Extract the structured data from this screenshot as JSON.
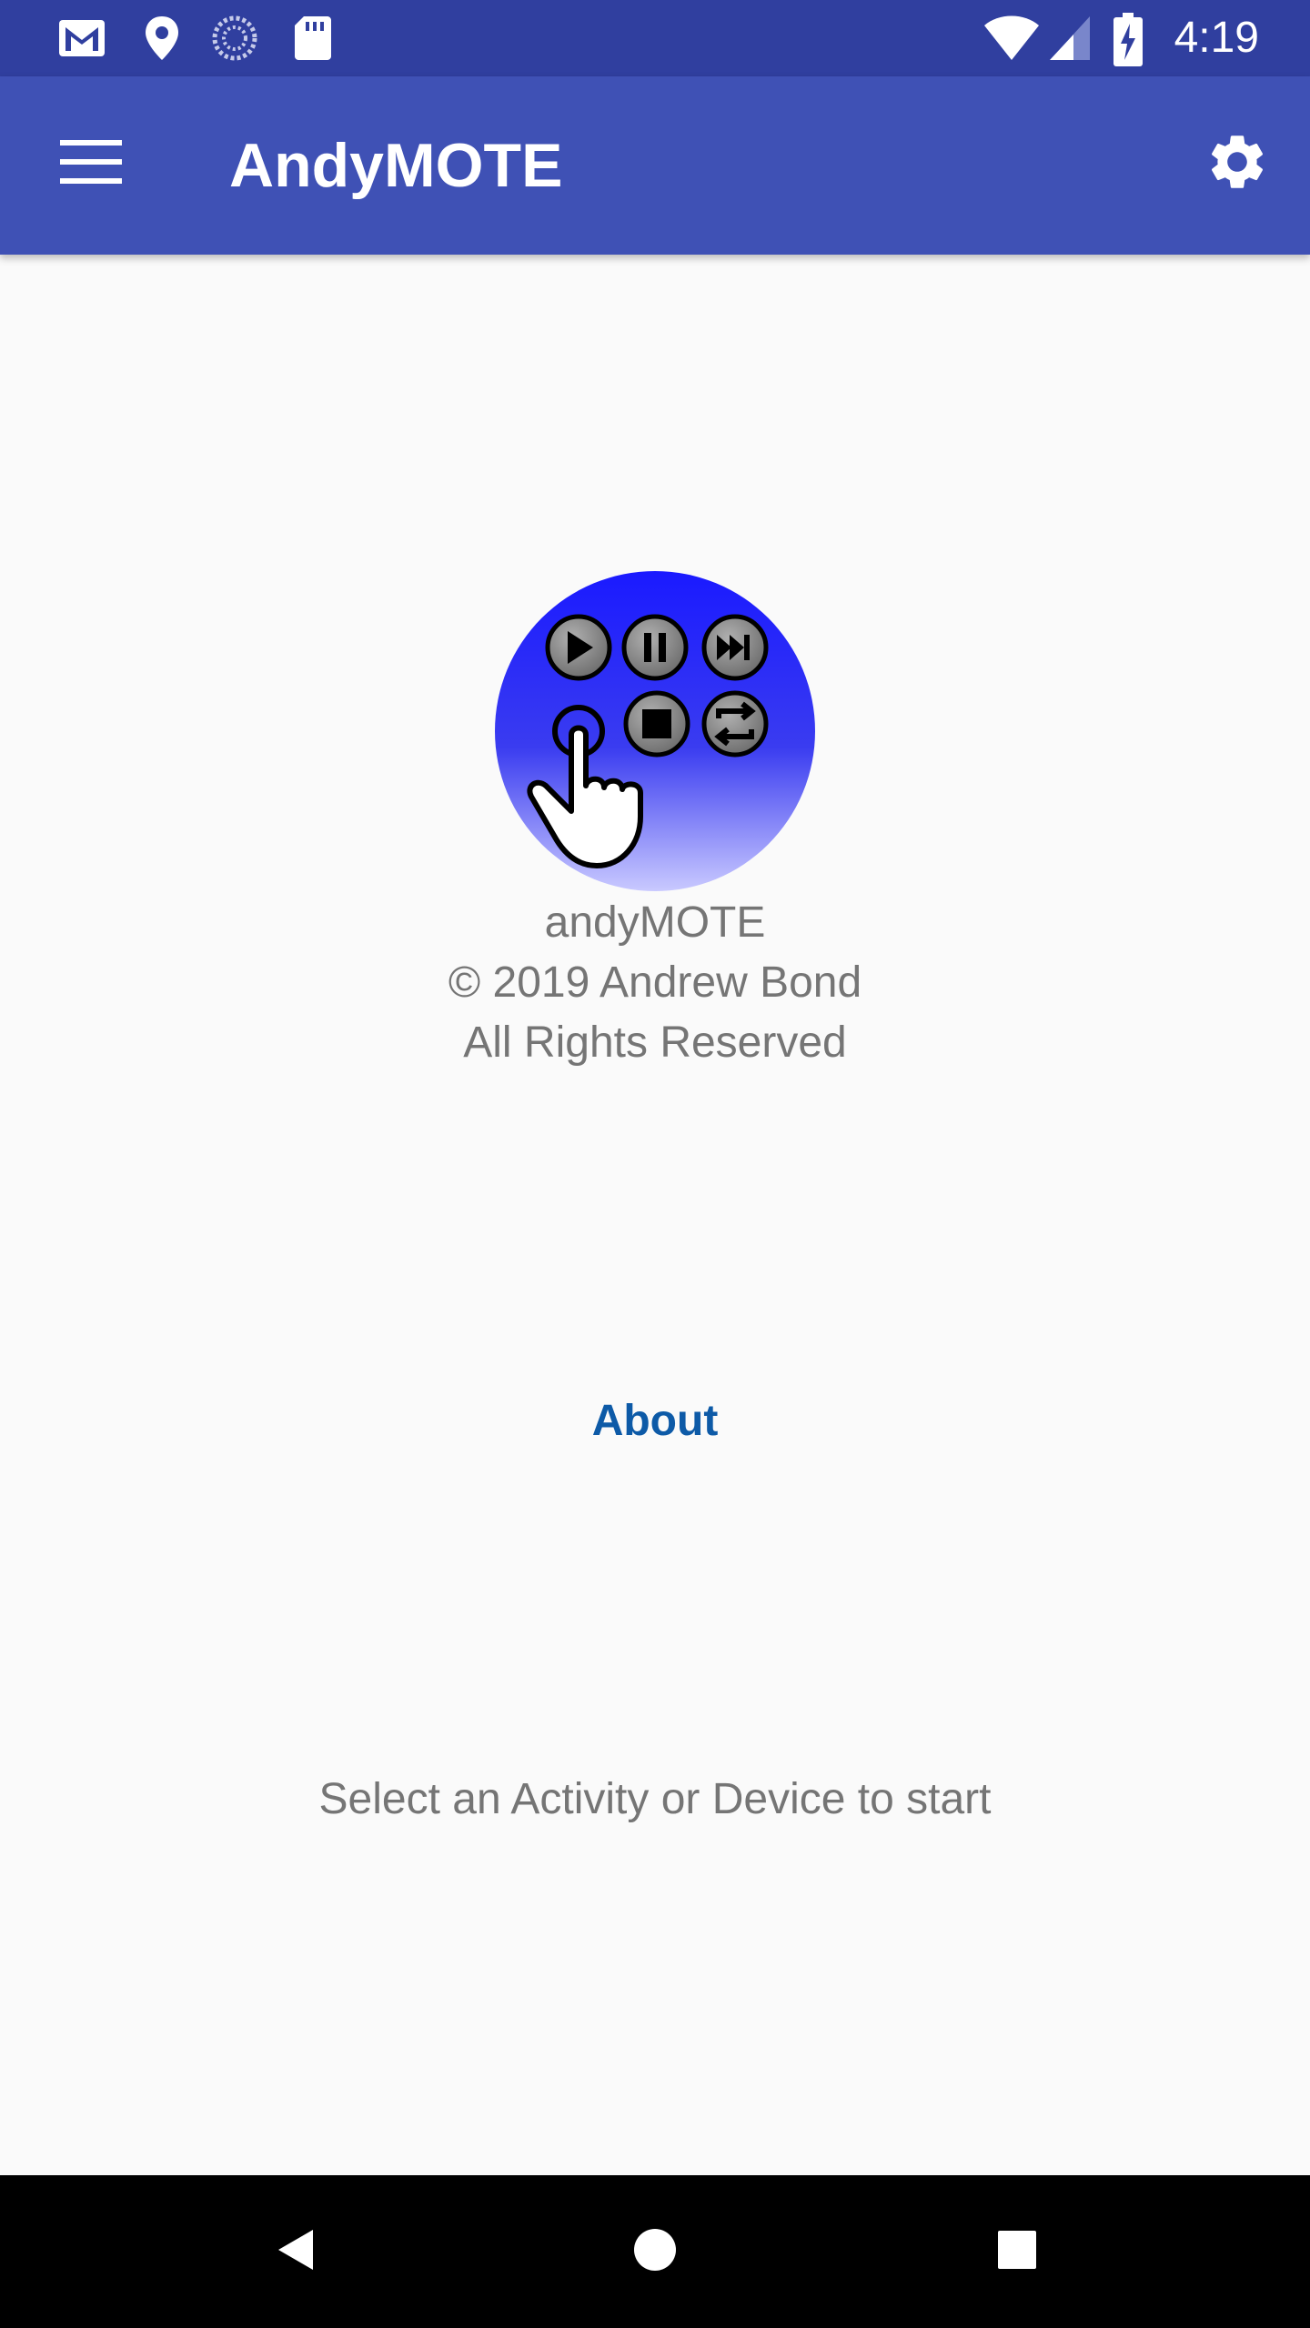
{
  "status_bar": {
    "time": "4:19",
    "left_icons": [
      "gmail-icon",
      "location-pin-icon",
      "sync-spinner-icon",
      "sd-card-icon"
    ],
    "right_icons": [
      "wifi-icon",
      "cell-signal-icon",
      "battery-charging-icon"
    ]
  },
  "app_bar": {
    "title": "AndyMOTE",
    "menu_icon": "hamburger-menu-icon",
    "settings_icon": "gear-icon",
    "color": "#3f51b5",
    "status_color": "#303f9f"
  },
  "splash": {
    "logo_icon": "andymote-logo-icon",
    "app_name": "andyMOTE",
    "copyright": "© 2019 Andrew Bond",
    "rights": "All Rights Reserved"
  },
  "about": {
    "label": "About",
    "color": "#0d5aa7"
  },
  "hint": {
    "text": "Select an Activity or Device to start"
  },
  "nav_bar": {
    "icons": [
      "back-icon",
      "home-icon",
      "recents-icon"
    ]
  }
}
